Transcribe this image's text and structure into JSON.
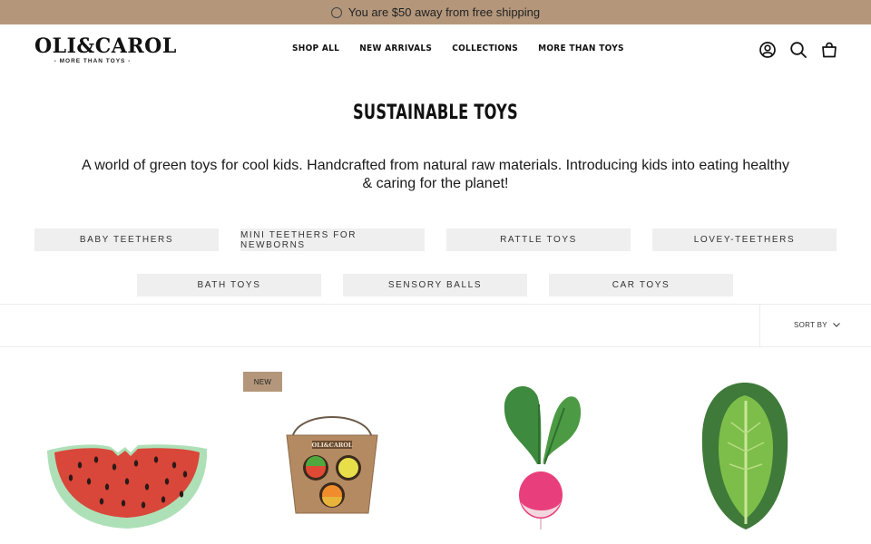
{
  "announcement": {
    "text": "You are $50 away from free shipping"
  },
  "header": {
    "logo": {
      "brand": "OLI&CAROL",
      "tagline": "- MORE THAN TOYS -"
    },
    "nav": [
      "SHOP ALL",
      "NEW ARRIVALS",
      "COLLECTIONS",
      "MORE THAN TOYS"
    ],
    "icons": [
      "account-icon",
      "search-icon",
      "cart-icon"
    ]
  },
  "page": {
    "title": "SUSTAINABLE TOYS",
    "description": "A world of green toys for cool kids. Handcrafted from natural raw materials. Introducing kids into eating healthy & caring for the planet!"
  },
  "categories": [
    "BABY TEETHERS",
    "MINI TEETHERS FOR NEWBORNS",
    "RATTLE TOYS",
    "LOVEY-TEETHERS",
    "BATH TOYS",
    "SENSORY BALLS",
    "CAR TOYS"
  ],
  "toolbar": {
    "sort_label": "SORT BY"
  },
  "products": [
    {
      "name": "watermelon-teether",
      "badge": ""
    },
    {
      "name": "sensory-balls-box",
      "badge": "NEW",
      "box_label": "OLI&CAROL"
    },
    {
      "name": "radish-teether",
      "badge": ""
    },
    {
      "name": "lettuce-teether",
      "badge": ""
    }
  ],
  "colors": {
    "announcement_bg": "#b4977b",
    "pill_bg": "#efefef",
    "badge_bg": "#b4977b"
  }
}
